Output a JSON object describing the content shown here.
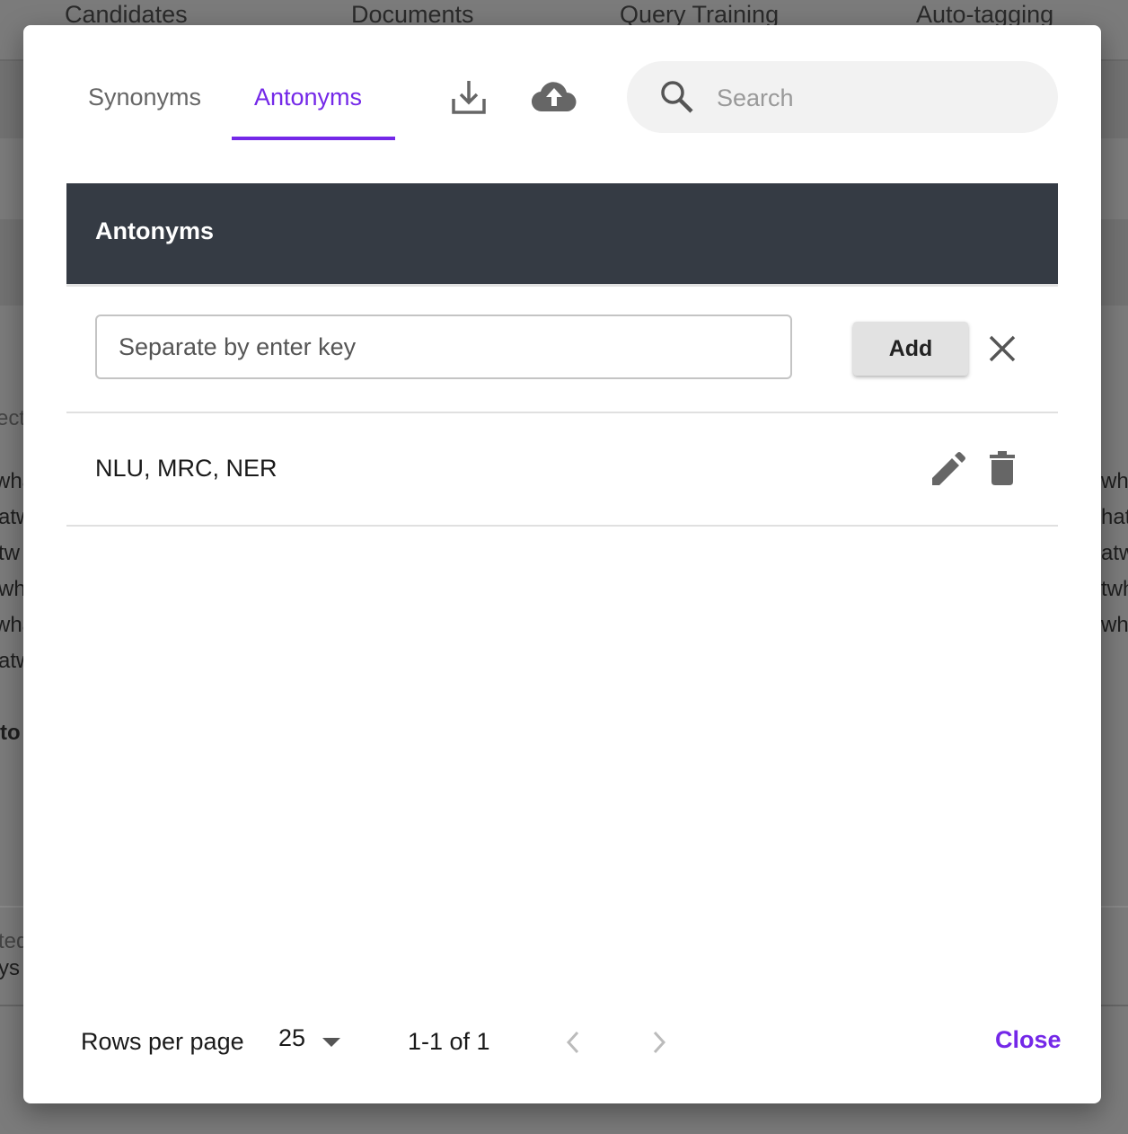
{
  "background": {
    "tabs": [
      "Candidates",
      "Documents",
      "Query Training",
      "Auto-tagging"
    ],
    "left_fragments": [
      "ect",
      "wha",
      "atw",
      "tw",
      "wh",
      "wha",
      "atw",
      "to",
      "ted",
      "ys"
    ],
    "right_fragments": [
      "wh",
      "hat",
      "atw",
      "twh",
      "wh"
    ]
  },
  "dialog": {
    "tabs": [
      {
        "label": "Synonyms",
        "active": false
      },
      {
        "label": "Antonyms",
        "active": true
      }
    ],
    "icons": {
      "download": "download-icon",
      "upload": "cloud-upload-icon",
      "search": "search-icon"
    },
    "search": {
      "placeholder": "Search",
      "value": ""
    },
    "table_title": "Antonyms",
    "entry": {
      "placeholder": "Separate by enter key",
      "value": ""
    },
    "add_label": "Add",
    "rows": [
      {
        "text": "NLU, MRC, NER"
      }
    ],
    "pagination": {
      "rows_per_page_label": "Rows per page",
      "rows_per_page": "25",
      "range": "1-1 of 1"
    },
    "close_label": "Close",
    "accent_color": "#7428e8",
    "header_color": "#353b44"
  }
}
